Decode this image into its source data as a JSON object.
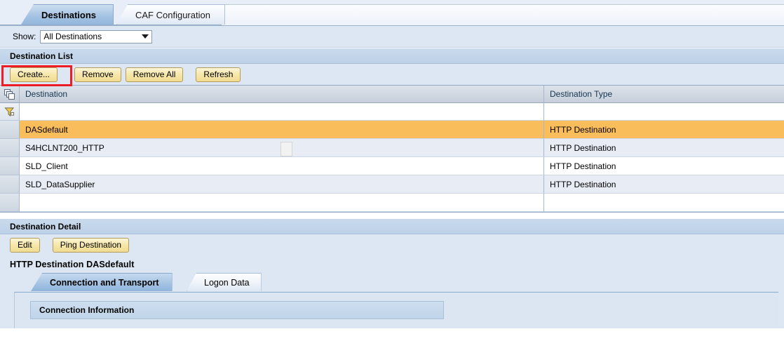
{
  "tabs": {
    "active": "Destinations",
    "inactive": "CAF Configuration"
  },
  "filter_bar": {
    "label": "Show:",
    "selected": "All Destinations",
    "options": [
      "All Destinations"
    ],
    "dropdown_icon": "chevron-down-icon"
  },
  "destination_list": {
    "section_title": "Destination List",
    "buttons": {
      "create": "Create...",
      "remove": "Remove",
      "remove_all": "Remove All",
      "refresh": "Refresh"
    },
    "highlight_color": "#ee1c25",
    "highlighted_button": "Create...",
    "table": {
      "header_icon": "select-all-copy-icon",
      "filter_icon": "filter-funnel-icon",
      "columns": [
        "Destination",
        "Destination Type"
      ],
      "filter_values": [
        "",
        ""
      ],
      "rows": [
        {
          "destination": "DASdefault",
          "type": "HTTP Destination",
          "selected": true
        },
        {
          "destination": "S4HCLNT200_HTTP",
          "type": "HTTP Destination",
          "selected": false
        },
        {
          "destination": "SLD_Client",
          "type": "HTTP Destination",
          "selected": false
        },
        {
          "destination": "SLD_DataSupplier",
          "type": "HTTP Destination",
          "selected": false
        },
        {
          "destination": "",
          "type": "",
          "selected": false
        }
      ],
      "selected_row_color": "#fabd5c"
    }
  },
  "destination_detail": {
    "section_title": "Destination Detail",
    "buttons": {
      "edit": "Edit",
      "ping": "Ping Destination"
    },
    "title": "HTTP Destination DASdefault",
    "tabs": {
      "active": "Connection and Transport",
      "inactive": "Logon Data"
    },
    "panel": {
      "connection_information": "Connection Information"
    }
  }
}
